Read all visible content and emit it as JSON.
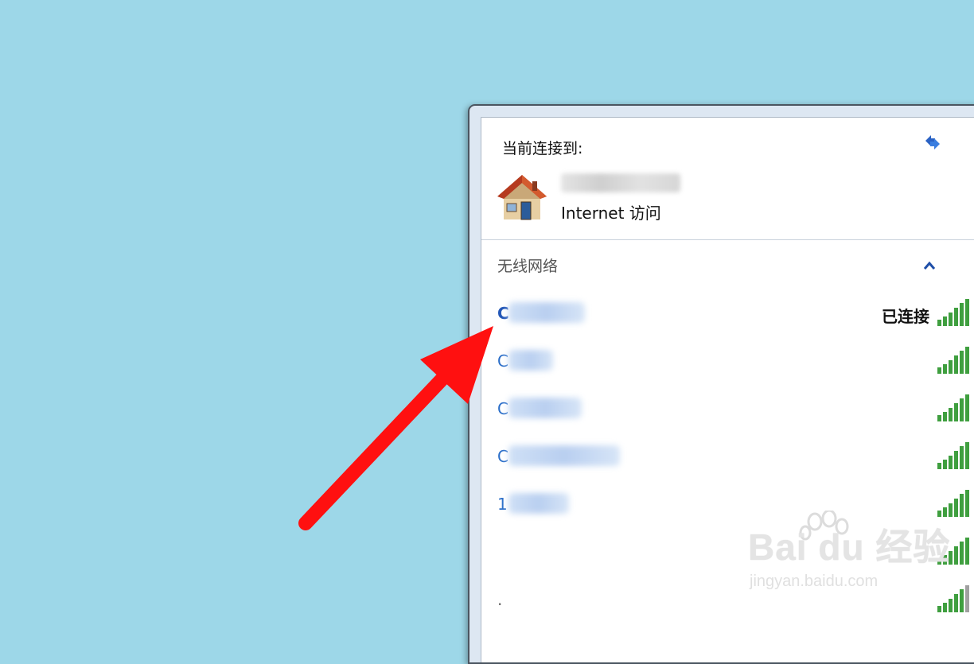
{
  "popup": {
    "current_label": "当前连接到:",
    "current_network": {
      "access": "Internet 访问",
      "icon": "house-icon"
    },
    "wireless_label": "无线网络",
    "icons": {
      "refresh": "refresh-icon",
      "collapse": "chevron-up-icon",
      "signal": "signal-bars-icon"
    },
    "networks": [
      {
        "prefix": "C",
        "status": "已连接",
        "connected": true
      },
      {
        "prefix": "C",
        "status": ""
      },
      {
        "prefix": "C",
        "status": ""
      },
      {
        "prefix": "C",
        "status": ""
      },
      {
        "prefix": "1",
        "status": ""
      },
      {
        "prefix": "",
        "status": ""
      },
      {
        "prefix": ".",
        "status": ""
      }
    ]
  },
  "watermark": {
    "brand": "Bai du 经验",
    "url": "jingyan.baidu.com"
  },
  "colors": {
    "desktop": "#9dd7e8",
    "link": "#2c6fc9",
    "signal": "#3f9f3f",
    "arrow": "#ff1010"
  }
}
